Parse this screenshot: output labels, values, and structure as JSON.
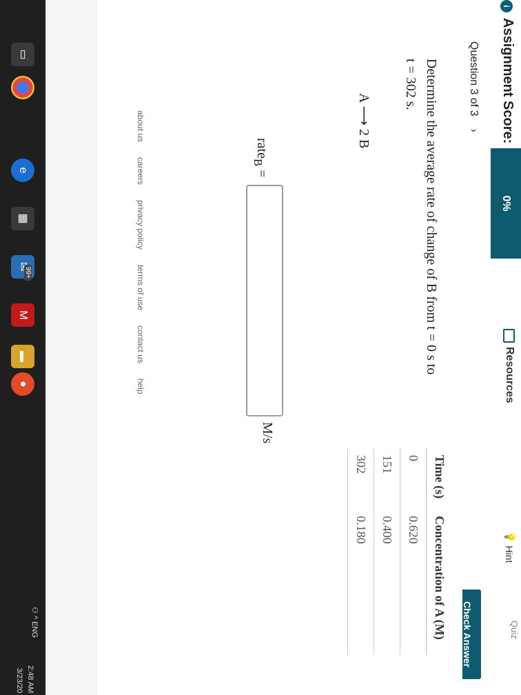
{
  "header": {
    "quiz_label": "Quiz",
    "score_label": "Assignment Score:",
    "score_value": "0%",
    "resources_label": "Resources",
    "hint_label": "Hint",
    "question_nav": "Question 3 of 3",
    "check_answer_label": "Check Answer"
  },
  "question": {
    "prompt_line1": "Determine the average rate of change of B from t = 0 s to",
    "prompt_line2": "t = 302 s.",
    "reaction": "A ⟶ 2 B",
    "rate_label": "rate",
    "rate_subscript": "B",
    "rate_equals": "=",
    "unit": "M/s",
    "table": {
      "headers": [
        "Time (s)",
        "Concentration of A (M)"
      ],
      "rows": [
        [
          "0",
          "0.620"
        ],
        [
          "151",
          "0.400"
        ],
        [
          "302",
          "0.180"
        ]
      ]
    }
  },
  "footer": {
    "links": [
      "about us",
      "careers",
      "privacy policy",
      "terms of use",
      "contact us",
      "help"
    ]
  },
  "taskbar": {
    "mail_badge": "99+",
    "tray": "ENG",
    "time": "2:48 AM",
    "date": "3/23/20"
  }
}
